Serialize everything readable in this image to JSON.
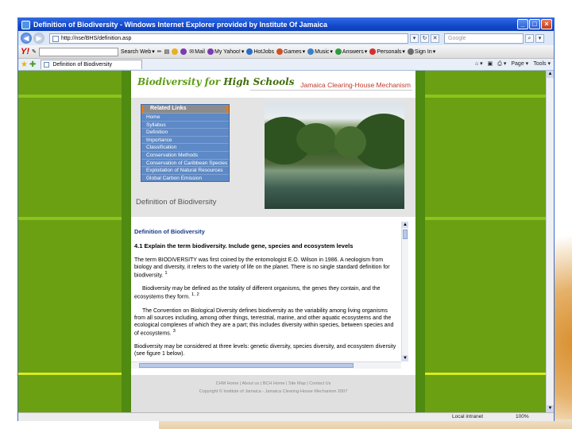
{
  "window": {
    "title": "Definition of Biodiversity - Windows Internet Explorer provided by Institute Of Jamaica",
    "buttons": [
      "_",
      "□",
      "×"
    ]
  },
  "address_bar": {
    "url": "http://nse/BHS/definition.asp",
    "search_placeholder": "Google"
  },
  "yahoo_toolbar": {
    "logo": "Y!",
    "items": [
      "Search Web",
      "Mail",
      "My Yahoo!",
      "HotJobs",
      "Games",
      "Music",
      "Answers",
      "Personals",
      "Sign In"
    ]
  },
  "favorites_bar": {
    "tab_title": "Definition of Biodiversity",
    "commands": [
      "Page",
      "Tools"
    ]
  },
  "site": {
    "logo_main": "Biodiversity for ",
    "logo_emph": "High Schools",
    "chm_title": "Jamaica Clearing-House Mechanism",
    "related_links_title": "Related Links",
    "related_links": [
      "Home",
      "Syllabus",
      "Definition",
      "Importance",
      "Classification",
      "Conservation Methods",
      "Conservation of Caribbean Species",
      "Exploitation of Natural Resources",
      "Global Carbon Emission"
    ],
    "page_heading": "Definition of Biodiversity"
  },
  "content": {
    "heading": "Definition of Biodiversity",
    "question": "4.1    Explain the term biodiversity.   Include gene, species and ecosystem levels",
    "p1": "The term BIODIVERSITY was first coined by the entomologist E.O. Wilson in 1986.  A neologism from biology and diversity, it refers to the variety of life on the planet.  There is no single standard definition for biodiversity.",
    "p1_ref": "1",
    "p2": "Biodiversity may be defined as the totality of different organisms, the genes they contain, and the ecosystems they form.",
    "p2_ref": "1, 2",
    "p3": "The Convention on Biological Diversity defines biodiversity as the variability among living organisms from all sources including, among other things, terrestrial, marine, and other aquatic ecosystems and the ecological complexes of which they are a part; this includes diversity within species, between species and of ecosystems.",
    "p3_ref": "3",
    "p4": "Biodiversity may be considered at three levels: genetic diversity, species diversity, and ecosystem diversity (see figure 1 below)."
  },
  "footer": {
    "links": "CHM Home | About us | BCH Home | Site Map | Contact Us",
    "copyright": "Copyright © Institute of Jamaica - Jamaica Clearing-House Mechanism 2007"
  },
  "status_bar": {
    "zone": "Local intranet",
    "zoom": "100%"
  }
}
